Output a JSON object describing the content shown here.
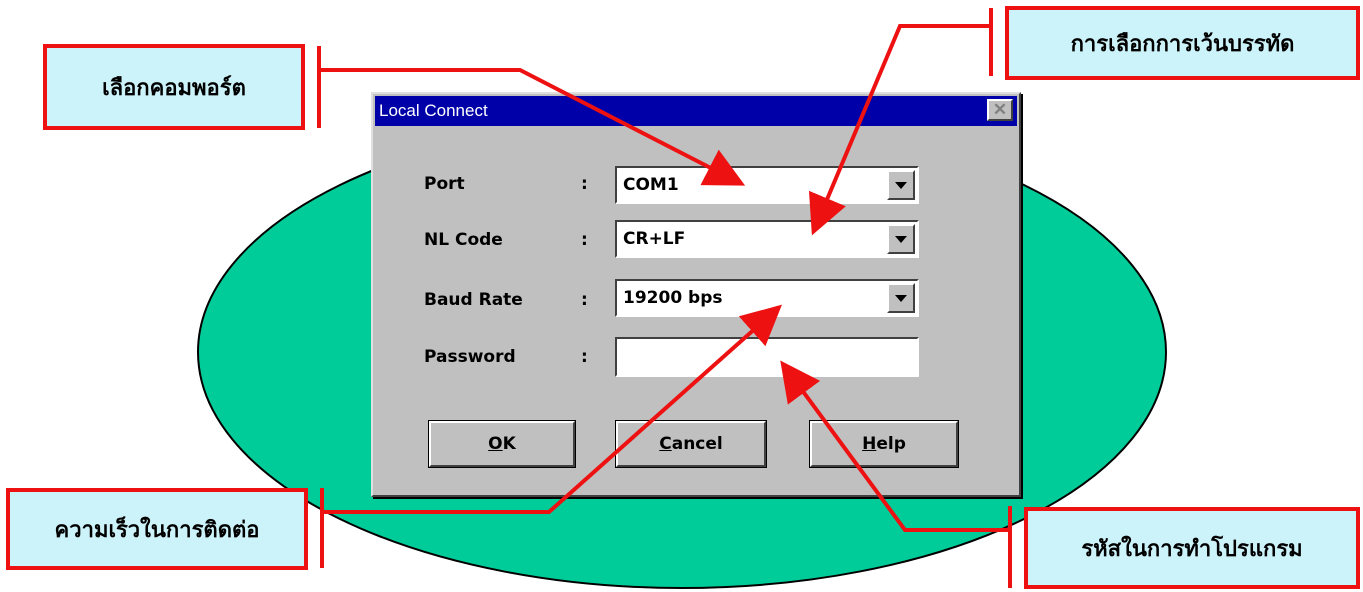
{
  "colors": {
    "ellipse_fill": "#00cc99",
    "ellipse_stroke": "#000000",
    "dialog_bg": "#c0c0c0",
    "titlebar_bg": "#0000a8",
    "callout_bg": "#cdf3fa",
    "callout_border": "#ee1111",
    "arrow": "#ee1111"
  },
  "dialog": {
    "title": "Local Connect",
    "close_glyph": "✕",
    "fields": {
      "port": {
        "label": "Port",
        "colon": ":",
        "value": "COM1"
      },
      "nl_code": {
        "label": "NL Code",
        "colon": ":",
        "value": "CR+LF"
      },
      "baud_rate": {
        "label": "Baud Rate",
        "colon": ":",
        "value": "19200 bps"
      },
      "password": {
        "label": "Password",
        "colon": ":",
        "value": ""
      }
    },
    "buttons": {
      "ok": {
        "mnemonic": "O",
        "rest": "K"
      },
      "cancel": {
        "mnemonic": "C",
        "rest": "ancel"
      },
      "help": {
        "mnemonic": "H",
        "rest": "elp"
      }
    }
  },
  "callouts": {
    "port": "เลือกคอมพอร์ต",
    "nl_code": "การเลือกการเว้นบรรทัด",
    "baud_rate": "ความเร็วในการติดต่อ",
    "password": "รหัสในการทำโปรแกรม"
  },
  "icons": {
    "dropdown": "chevron-down-icon",
    "close": "close-icon"
  }
}
